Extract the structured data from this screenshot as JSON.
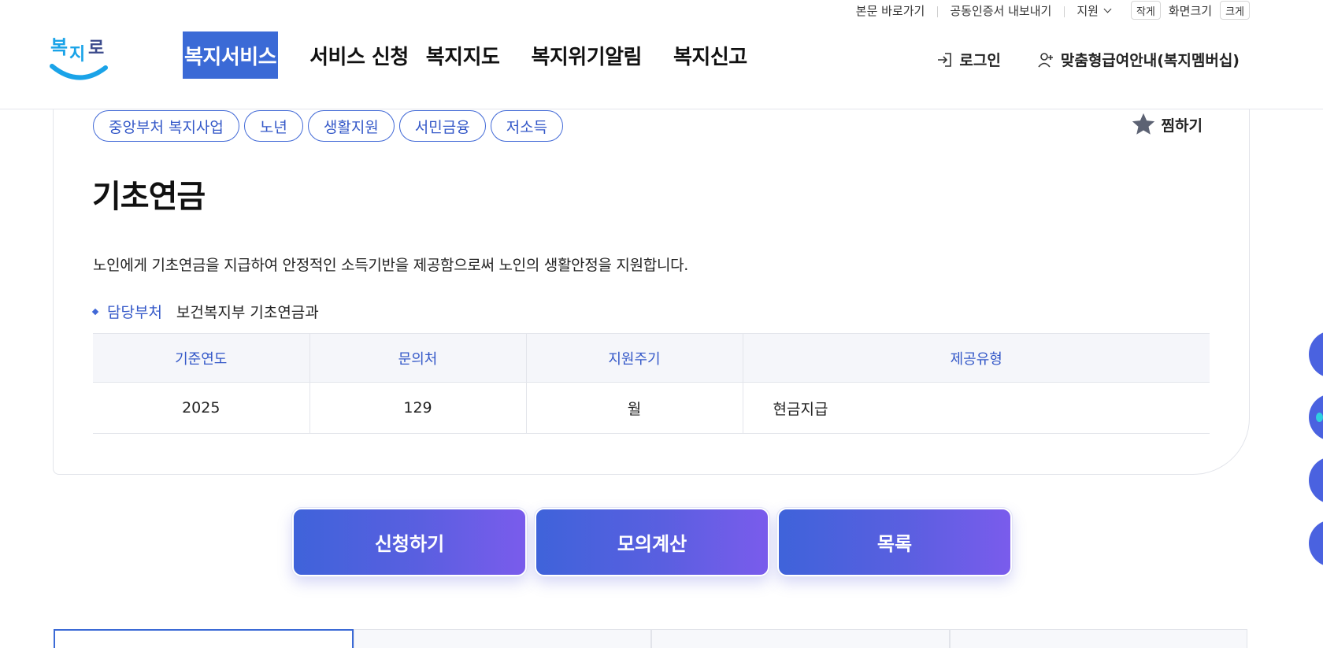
{
  "utility": {
    "skip_to_content": "본문 바로가기",
    "export_certificate": "공동인증서 내보내기",
    "support": "지원",
    "font_small": "작게",
    "font_size": "화면크기",
    "font_large": "크게"
  },
  "header": {
    "logo_text": "복지로",
    "nav": [
      {
        "label": "복지서비스"
      },
      {
        "label": "서비스 신청"
      },
      {
        "label": "복지지도"
      },
      {
        "label": "복지위기알림"
      },
      {
        "label": "복지신고"
      }
    ],
    "login": "로그인",
    "membership": "맞춤형급여안내(복지멤버십)"
  },
  "service": {
    "tags": [
      "중앙부처 복지사업",
      "노년",
      "생활지원",
      "서민금융",
      "저소득"
    ],
    "bookmark": "찜하기",
    "title": "기초연금",
    "description": "노인에게 기초연금을 지급하여 안정적인 소득기반을 제공함으로써 노인의 생활안정을 지원합니다.",
    "dept_label": "담당부처",
    "dept_value": "보건복지부 기초연금과",
    "table": {
      "headers": [
        "기준연도",
        "문의처",
        "지원주기",
        "제공유형"
      ],
      "row": [
        "2025",
        "129",
        "월",
        "현금지급"
      ]
    }
  },
  "actions": {
    "apply": "신청하기",
    "simulate": "모의계산",
    "list": "목록"
  },
  "colors": {
    "primary": "#3b6ad6",
    "tag_border": "#4068d6",
    "gradient_start": "#3f63da",
    "gradient_end": "#7a5cec",
    "logo_blue": "#1aa3e8",
    "logo_navy": "#3b4a8c"
  }
}
